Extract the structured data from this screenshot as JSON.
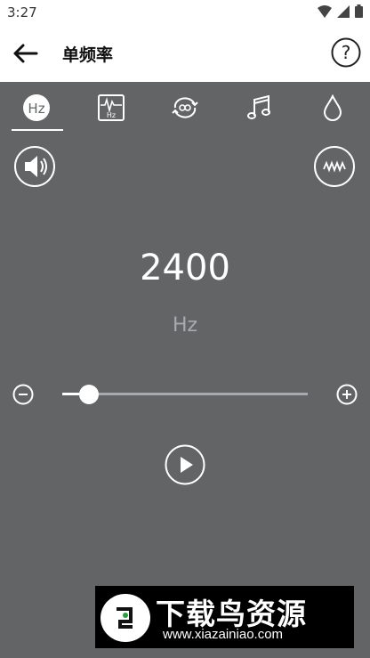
{
  "status_bar": {
    "time": "3:27",
    "icons": [
      "wifi-icon",
      "signal-icon",
      "battery-icon"
    ]
  },
  "app_bar": {
    "title": "单频率",
    "back_icon": "arrow-left-icon",
    "help_icon": "question-circle-icon"
  },
  "tabs": [
    {
      "icon": "hz-icon",
      "selected": true
    },
    {
      "icon": "sweep-hz-icon",
      "selected": false
    },
    {
      "icon": "loop-icon",
      "selected": false
    },
    {
      "icon": "music-note-icon",
      "selected": false
    },
    {
      "icon": "drop-icon",
      "selected": false
    }
  ],
  "controls": {
    "speaker_icon": "speaker-icon",
    "waveform_icon": "waveform-icon",
    "play_icon": "play-icon"
  },
  "frequency": {
    "value": "2400",
    "unit": "Hz"
  },
  "slider": {
    "fraction": 0.11,
    "minus_icon": "minus-circle-icon",
    "plus_icon": "plus-circle-icon"
  },
  "watermark": {
    "brand": "下载鸟资源",
    "url": "www.xiazainiao.com"
  },
  "colors": {
    "background": "#636466",
    "accent": "#ffffff",
    "muted": "#a9aaad"
  }
}
